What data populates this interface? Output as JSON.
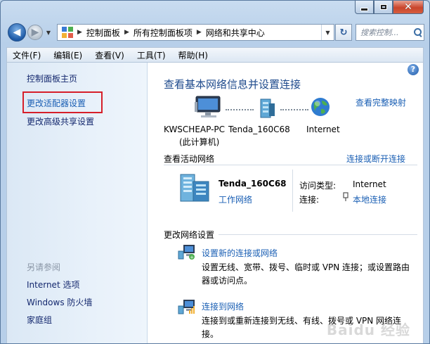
{
  "window": {
    "caption_close": "✕"
  },
  "nav": {
    "breadcrumbs": [
      "控制面板",
      "所有控制面板项",
      "网络和共享中心"
    ],
    "search_placeholder": "搜索控制..."
  },
  "menu": [
    "文件(F)",
    "编辑(E)",
    "查看(V)",
    "工具(T)",
    "帮助(H)"
  ],
  "left_pane": {
    "home": "控制面板主页",
    "adapter_settings": "更改适配器设置",
    "advanced_sharing": "更改高级共享设置",
    "see_also_heading": "另请参阅",
    "see_also": [
      "Internet 选项",
      "Windows 防火墙",
      "家庭组"
    ]
  },
  "main": {
    "title": "查看基本网络信息并设置连接",
    "full_map_link": "查看完整映射",
    "nodes": {
      "pc_name": "KWSCHEAP-PC",
      "pc_sub": "(此计算机)",
      "router": "Tenda_160C68",
      "internet": "Internet"
    },
    "active_networks_label": "查看活动网络",
    "connect_disconnect_link": "连接或断开连接",
    "active_network": {
      "name": "Tenda_160C68",
      "type_link": "工作网络",
      "access_type_label": "访问类型:",
      "access_type_value": "Internet",
      "connections_label": "连接:",
      "connections_value": "本地连接"
    },
    "change_settings_label": "更改网络设置",
    "tasks": [
      {
        "title": "设置新的连接或网络",
        "desc": "设置无线、宽带、拨号、临时或 VPN 连接；或设置路由器或访问点。"
      },
      {
        "title": "连接到网络",
        "desc": "连接到或重新连接到无线、有线、拨号或 VPN 网络连接。"
      }
    ]
  },
  "watermark": "Baidu 经验",
  "colors": {
    "accent_link": "#1a5fb4",
    "title_blue": "#1e4a8c",
    "highlight_red": "#d61f2a"
  }
}
